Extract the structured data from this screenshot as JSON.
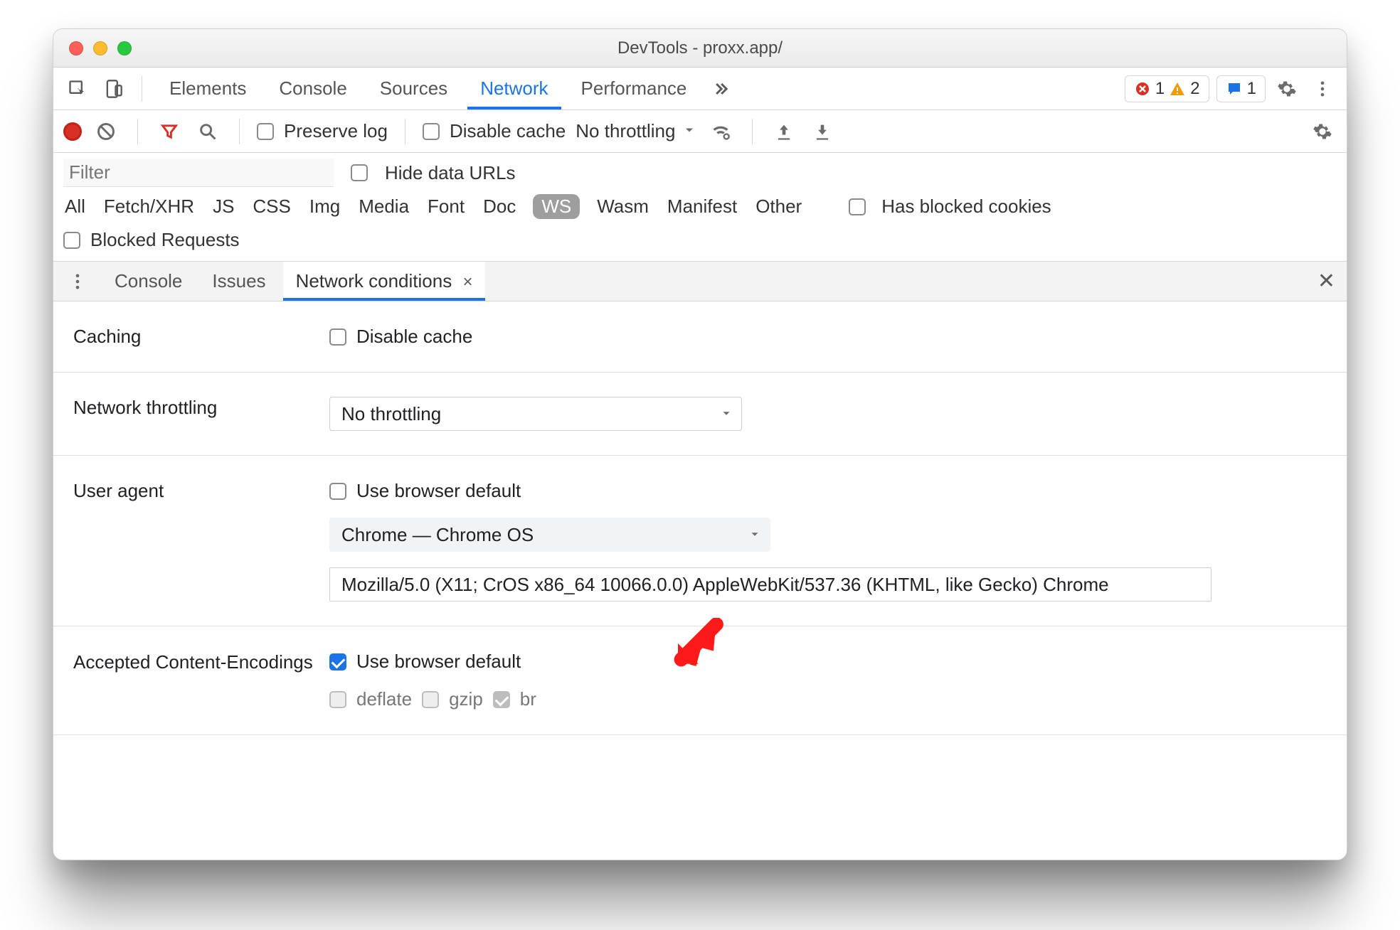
{
  "window": {
    "title": "DevTools - proxx.app/"
  },
  "tabs": {
    "items": [
      "Elements",
      "Console",
      "Sources",
      "Network",
      "Performance"
    ],
    "active": "Network",
    "overflow_icon": "chevron-right-double",
    "counters": {
      "errors": "1",
      "warnings": "2",
      "messages": "1"
    }
  },
  "network_toolbar": {
    "preserve_log": "Preserve log",
    "disable_cache": "Disable cache",
    "throttling_value": "No throttling"
  },
  "filter": {
    "placeholder": "Filter",
    "hide_data_urls": "Hide data URLs",
    "types": [
      "All",
      "Fetch/XHR",
      "JS",
      "CSS",
      "Img",
      "Media",
      "Font",
      "Doc",
      "WS",
      "Wasm",
      "Manifest",
      "Other"
    ],
    "selected_type": "WS",
    "has_blocked_cookies": "Has blocked cookies",
    "blocked_requests": "Blocked Requests"
  },
  "drawer": {
    "tabs": [
      "Console",
      "Issues",
      "Network conditions"
    ],
    "active": "Network conditions"
  },
  "conditions": {
    "caching_label": "Caching",
    "caching_disable": "Disable cache",
    "throttling_label": "Network throttling",
    "throttling_value": "No throttling",
    "ua_label": "User agent",
    "ua_use_default": "Use browser default",
    "ua_select": "Chrome — Chrome OS",
    "ua_string": "Mozilla/5.0 (X11; CrOS x86_64 10066.0.0) AppleWebKit/537.36 (KHTML, like Gecko) Chrome",
    "enc_label": "Accepted Content-Encodings",
    "enc_use_default": "Use browser default",
    "enc_options": [
      "deflate",
      "gzip",
      "br"
    ]
  }
}
